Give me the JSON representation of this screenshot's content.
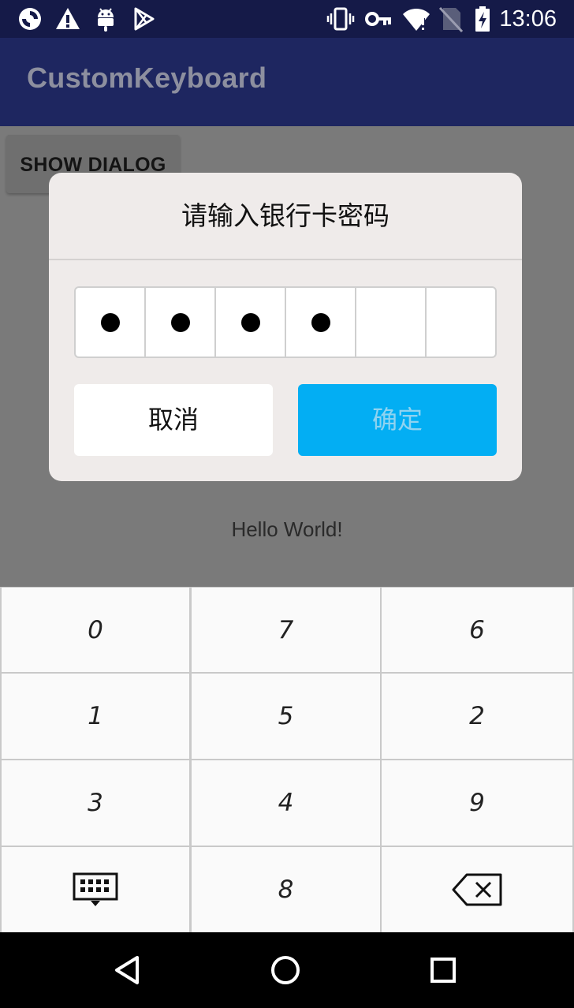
{
  "status_bar": {
    "time": "13:06",
    "left_icons": [
      "sync-icon",
      "warning-icon",
      "android-icon",
      "play-store-icon"
    ],
    "right_icons": [
      "vibrate-icon",
      "key-icon",
      "wifi-icon",
      "no-sim-icon",
      "battery-charging-icon"
    ]
  },
  "app_bar": {
    "title": "CustomKeyboard",
    "color": "#1e2660"
  },
  "content": {
    "show_dialog_label": "SHOW DIALOG",
    "hello_text": "Hello World!"
  },
  "dialog": {
    "title": "请输入银行卡密码",
    "password_length": 6,
    "filled_count": 4,
    "cancel_label": "取消",
    "confirm_label": "确定",
    "confirm_color": "#03aef3"
  },
  "keyboard": {
    "rows": [
      [
        "0",
        "7",
        "6"
      ],
      [
        "1",
        "5",
        "2"
      ],
      [
        "3",
        "4",
        "9"
      ],
      [
        "keyboard-hide-icon",
        "8",
        "backspace-icon"
      ]
    ]
  },
  "nav_bar": {
    "buttons": [
      "back-icon",
      "home-icon",
      "recents-icon"
    ]
  }
}
